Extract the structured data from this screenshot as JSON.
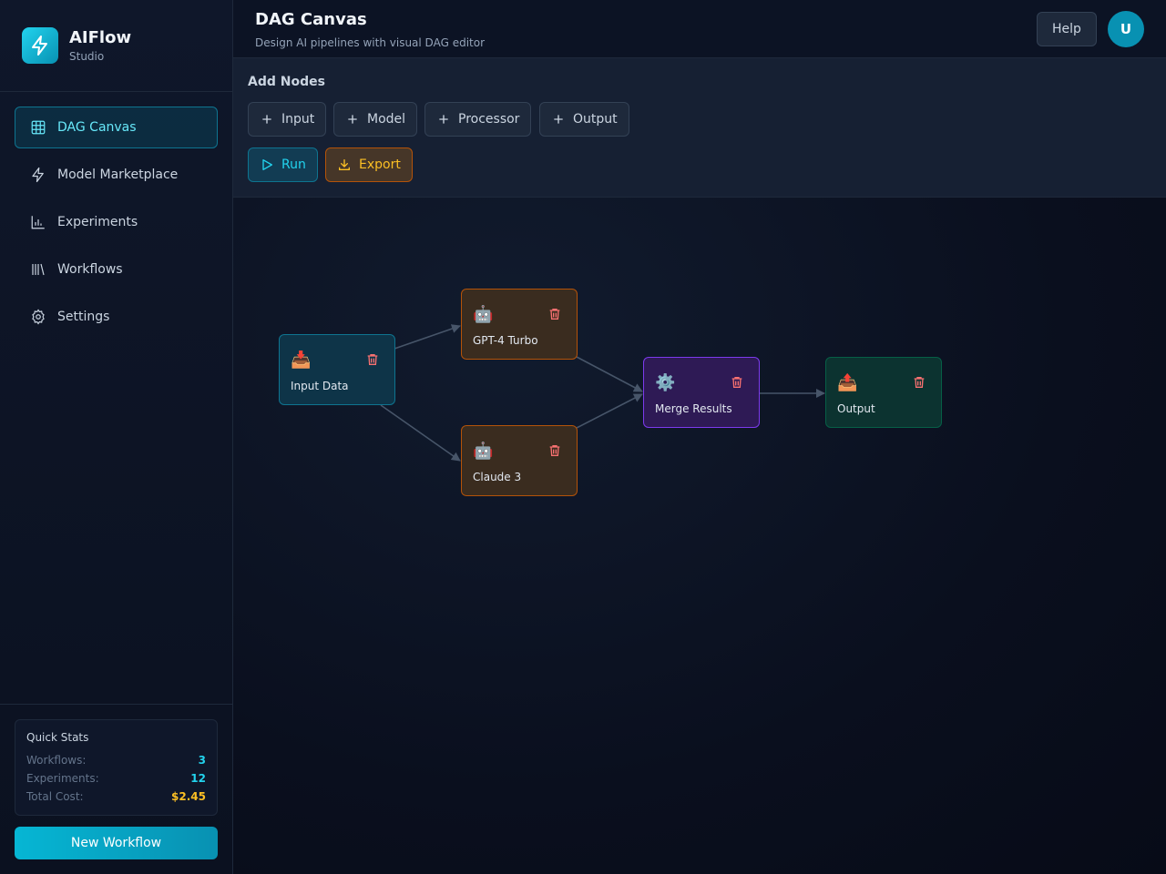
{
  "brand": {
    "name": "AIFlow",
    "sub": "Studio"
  },
  "nav": [
    {
      "label": "DAG Canvas",
      "icon": "grid-icon",
      "active": true
    },
    {
      "label": "Model Marketplace",
      "icon": "lightning-icon"
    },
    {
      "label": "Experiments",
      "icon": "bar-chart-icon"
    },
    {
      "label": "Workflows",
      "icon": "library-icon"
    },
    {
      "label": "Settings",
      "icon": "gear-icon"
    }
  ],
  "stats": {
    "title": "Quick Stats",
    "workflows_label": "Workflows:",
    "workflows_value": "3",
    "experiments_label": "Experiments:",
    "experiments_value": "12",
    "cost_label": "Total Cost:",
    "cost_value": "$2.45"
  },
  "new_workflow_label": "New Workflow",
  "header": {
    "title": "DAG Canvas",
    "subtitle": "Design AI pipelines with visual DAG editor",
    "help_label": "Help",
    "avatar_initial": "U"
  },
  "toolbar": {
    "title": "Add Nodes",
    "add_input": "Input",
    "add_model": "Model",
    "add_processor": "Processor",
    "add_output": "Output",
    "run": "Run",
    "export": "Export"
  },
  "colors": {
    "accent": "#22d3ee",
    "warning": "#fbbf24",
    "delete": "#f87171"
  },
  "nodes": [
    {
      "id": "input",
      "label": "Input Data",
      "emoji": "📥",
      "kind": "input"
    },
    {
      "id": "gpt4",
      "label": "GPT-4 Turbo",
      "emoji": "🤖",
      "kind": "model"
    },
    {
      "id": "claude",
      "label": "Claude 3",
      "emoji": "🤖",
      "kind": "model"
    },
    {
      "id": "merge",
      "label": "Merge Results",
      "emoji": "⚙️",
      "kind": "proc"
    },
    {
      "id": "output",
      "label": "Output",
      "emoji": "📤",
      "kind": "output"
    }
  ],
  "edges": [
    {
      "from": "input",
      "to": "gpt4"
    },
    {
      "from": "input",
      "to": "claude"
    },
    {
      "from": "gpt4",
      "to": "merge"
    },
    {
      "from": "claude",
      "to": "merge"
    },
    {
      "from": "merge",
      "to": "output"
    }
  ]
}
